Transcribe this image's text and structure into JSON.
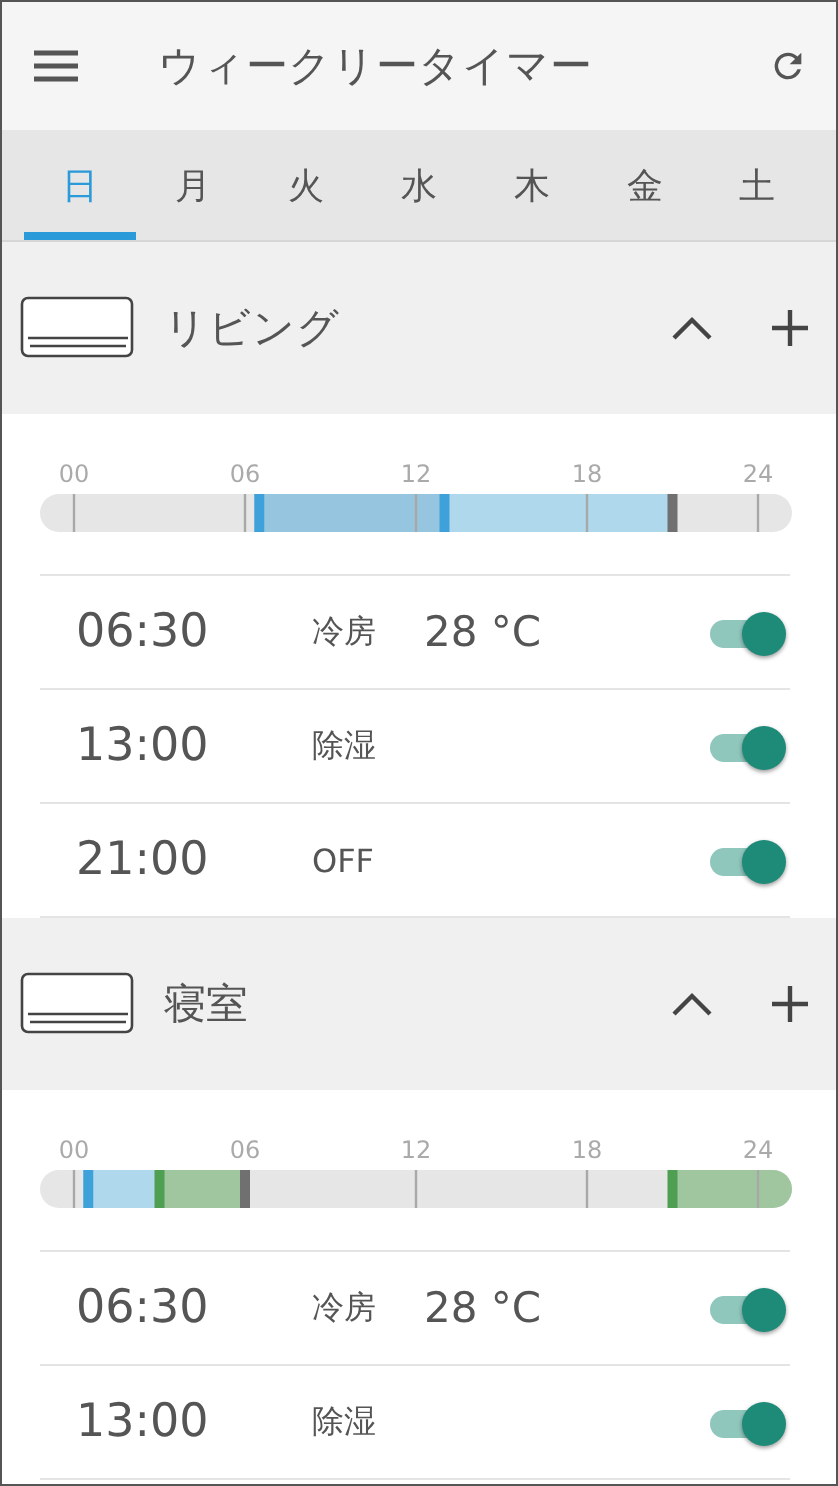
{
  "header": {
    "title": "ウィークリータイマー"
  },
  "tabs": [
    {
      "label": "日",
      "selected": true
    },
    {
      "label": "月",
      "selected": false
    },
    {
      "label": "火",
      "selected": false
    },
    {
      "label": "水",
      "selected": false
    },
    {
      "label": "木",
      "selected": false
    },
    {
      "label": "金",
      "selected": false
    },
    {
      "label": "土",
      "selected": false
    }
  ],
  "rooms": [
    {
      "name": "リビング",
      "expanded": true,
      "ticks": [
        "00",
        "06",
        "12",
        "18",
        "24"
      ],
      "timers": [
        {
          "time": "06:30",
          "mode": "冷房",
          "temp": "28 °C",
          "on": true
        },
        {
          "time": "13:00",
          "mode": "除湿",
          "on": true
        },
        {
          "time": "21:00",
          "mode": "OFF",
          "on": true
        }
      ]
    },
    {
      "name": "寝室",
      "expanded": true,
      "ticks": [
        "00",
        "06",
        "12",
        "18",
        "24"
      ],
      "timers": [
        {
          "time": "06:30",
          "mode": "冷房",
          "temp": "28 °C",
          "on": true
        },
        {
          "time": "13:00",
          "mode": "除湿",
          "on": true
        }
      ]
    }
  ]
}
